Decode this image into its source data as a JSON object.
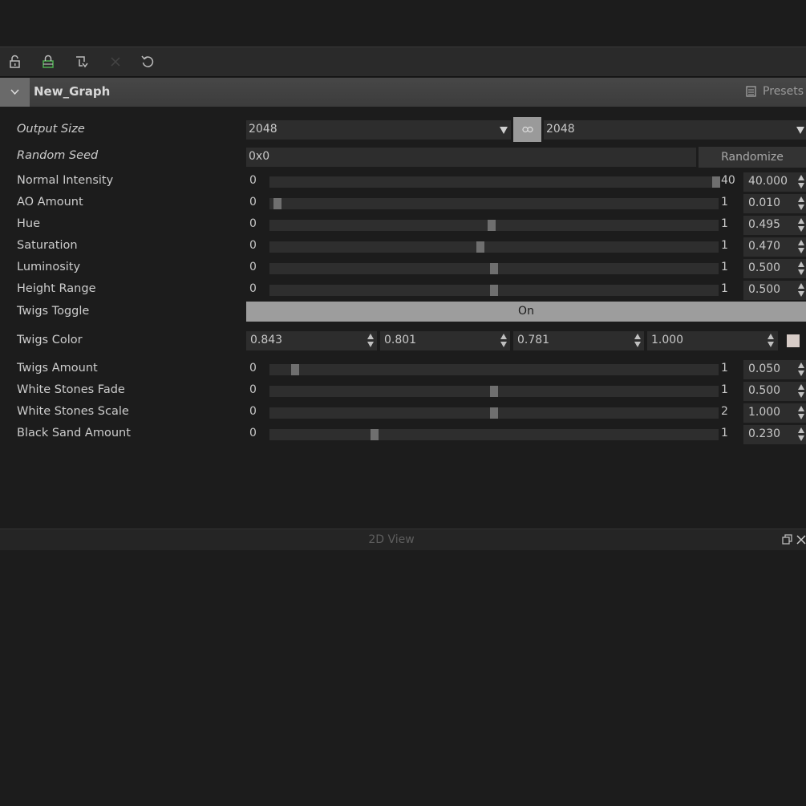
{
  "graph": {
    "title": "New_Graph",
    "presets_label": "Presets"
  },
  "output_size": {
    "label": "Output Size",
    "width": "2048",
    "height": "2048"
  },
  "random_seed": {
    "label": "Random Seed",
    "value": "0x0",
    "button_label": "Randomize"
  },
  "sliders": [
    {
      "label": "Normal Intensity",
      "min": "0",
      "max": "40",
      "value": "40.000",
      "fraction": 0.995
    },
    {
      "label": "AO Amount",
      "min": "0",
      "max": "1",
      "value": "0.010",
      "fraction": 0.018
    },
    {
      "label": "Hue",
      "min": "0",
      "max": "1",
      "value": "0.495",
      "fraction": 0.495
    },
    {
      "label": "Saturation",
      "min": "0",
      "max": "1",
      "value": "0.470",
      "fraction": 0.47
    },
    {
      "label": "Luminosity",
      "min": "0",
      "max": "1",
      "value": "0.500",
      "fraction": 0.5
    },
    {
      "label": "Height Range",
      "min": "0",
      "max": "1",
      "value": "0.500",
      "fraction": 0.5
    }
  ],
  "twigs_toggle": {
    "label": "Twigs Toggle",
    "value": "On"
  },
  "twigs_color": {
    "label": "Twigs Color",
    "r": "0.843",
    "g": "0.801",
    "b": "0.781",
    "a": "1.000",
    "swatch": "#d7ccc7"
  },
  "sliders2": [
    {
      "label": "Twigs Amount",
      "min": "0",
      "max": "1",
      "value": "0.050",
      "fraction": 0.057
    },
    {
      "label": "White Stones Fade",
      "min": "0",
      "max": "1",
      "value": "0.500",
      "fraction": 0.5
    },
    {
      "label": "White Stones Scale",
      "min": "0",
      "max": "2",
      "value": "1.000",
      "fraction": 0.5
    },
    {
      "label": "Black Sand Amount",
      "min": "0",
      "max": "1",
      "value": "0.230",
      "fraction": 0.234
    }
  ],
  "view": {
    "title": "2D View"
  },
  "toolbar": {
    "icons": [
      "unlock-icon",
      "lock-icon",
      "link-node-icon",
      "disabled-icon",
      "undo-icon"
    ]
  }
}
